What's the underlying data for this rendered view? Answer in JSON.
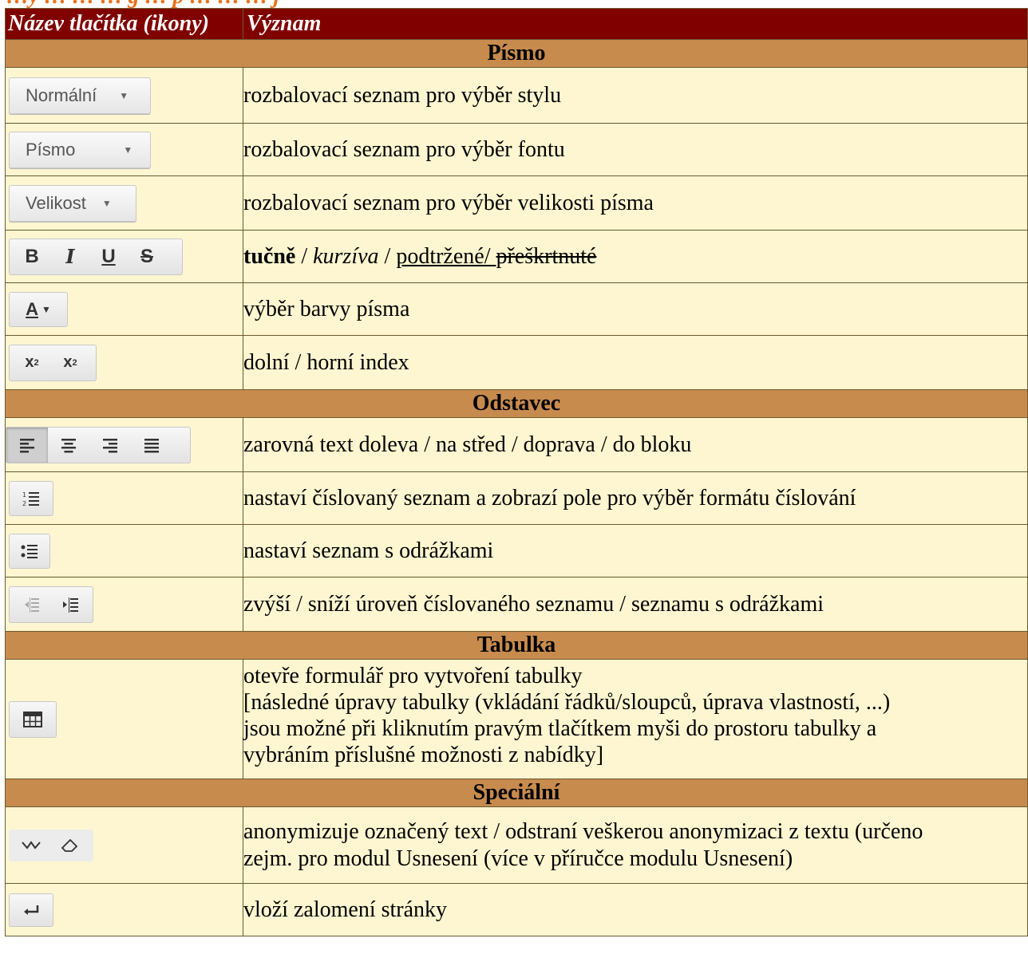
{
  "caption": "…y … … … g … p … … … j",
  "headers": [
    "Název tlačítka (ikony)",
    "Význam"
  ],
  "sections": [
    {
      "title": "Písmo",
      "rows": [
        {
          "control": "Normální",
          "desc": "rozbalovací seznam pro výběr stylu"
        },
        {
          "control": "Písmo",
          "desc": "rozbalovací seznam pro výběr fontu"
        },
        {
          "control": "Velikost",
          "desc": "rozbalovací seznam pro výběr velikosti písma"
        },
        {
          "glyphs": [
            "B",
            "I",
            "U",
            "S"
          ],
          "desc_bold": "tučně",
          "sep1": " / ",
          "desc_italic": "kurzíva",
          "sep2": " / ",
          "desc_underline": "podtržené/ ",
          "sep3": " ",
          "desc_strike": "přeškrtnuté"
        },
        {
          "glyphs": [
            "A"
          ],
          "desc": "výběr barvy písma"
        },
        {
          "desc": "dolní / horní index"
        }
      ]
    },
    {
      "title": "Odstavec",
      "rows": [
        {
          "desc": "zarovná text doleva / na střed / doprava / do bloku"
        },
        {
          "desc": "nastaví číslovaný seznam a zobrazí pole pro výběr formátu číslování"
        },
        {
          "desc": "nastaví seznam s odrážkami"
        },
        {
          "desc": "zvýší / sníží úroveň číslovaného seznamu / seznamu s odrážkami"
        }
      ]
    },
    {
      "title": "Tabulka",
      "rows": [
        {
          "desc_lines": [
            "otevře formulář pro vytvoření tabulky",
            "[následné úpravy tabulky (vkládání řádků/sloupců, úprava vlastností, ...)",
            "jsou možné při kliknutím pravým tlačítkem myši do prostoru tabulky a",
            "vybráním příslušné možnosti z nabídky]"
          ]
        }
      ]
    },
    {
      "title": "Speciální",
      "rows": [
        {
          "desc_lines": [
            "anonymizuje označený text / odstraní veškerou anonymizaci z textu (určeno",
            "zejm. pro modul Usnesení (více v příručce modulu Usnesení)"
          ]
        },
        {
          "desc": "vloží zalomení stránky"
        }
      ]
    }
  ]
}
